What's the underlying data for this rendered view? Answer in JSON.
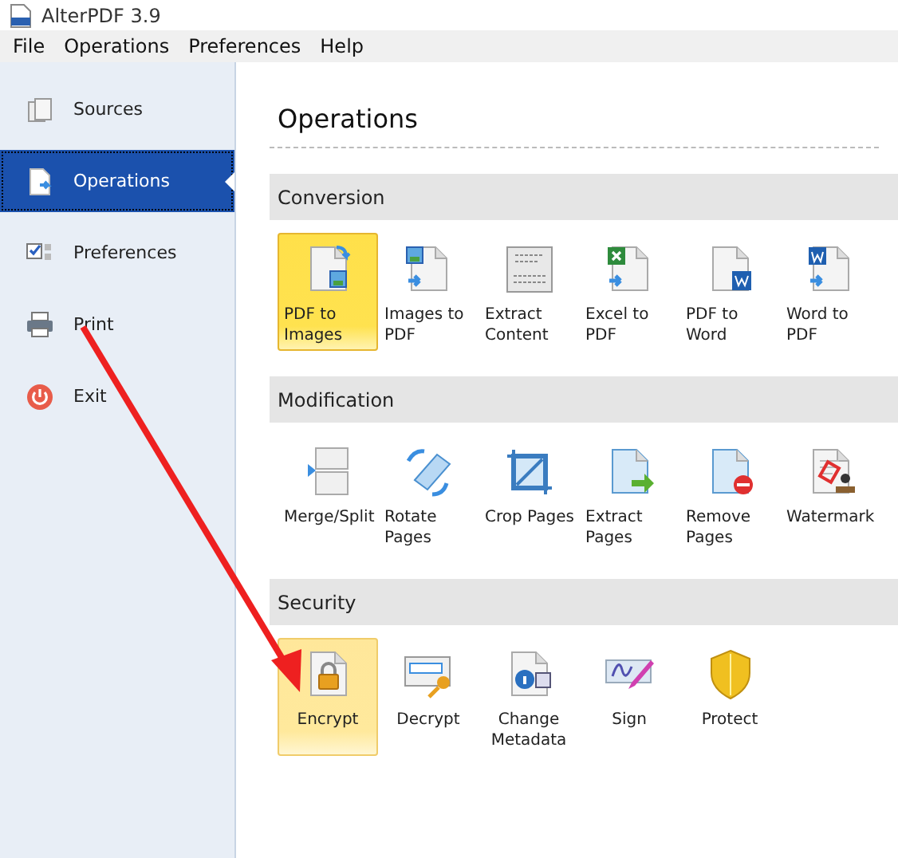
{
  "window": {
    "title": "AlterPDF 3.9"
  },
  "menu": [
    "File",
    "Operations",
    "Preferences",
    "Help"
  ],
  "sidebar": {
    "items": [
      {
        "label": "Sources",
        "selected": false
      },
      {
        "label": "Operations",
        "selected": true
      },
      {
        "label": "Preferences",
        "selected": false
      },
      {
        "label": "Print",
        "selected": false
      },
      {
        "label": "Exit",
        "selected": false
      }
    ]
  },
  "heading": "Operations",
  "sections": [
    {
      "title": "Conversion",
      "tiles": [
        {
          "label": "PDF to Images",
          "selected": true,
          "hovered": false
        },
        {
          "label": "Images to PDF",
          "selected": false,
          "hovered": false
        },
        {
          "label": "Extract Content",
          "selected": false,
          "hovered": false
        },
        {
          "label": "Excel to PDF",
          "selected": false,
          "hovered": false
        },
        {
          "label": "PDF to Word",
          "selected": false,
          "hovered": false
        },
        {
          "label": "Word to PDF",
          "selected": false,
          "hovered": false
        }
      ]
    },
    {
      "title": "Modification",
      "tiles": [
        {
          "label": "Merge/Split",
          "selected": false,
          "hovered": false
        },
        {
          "label": "Rotate Pages",
          "selected": false,
          "hovered": false
        },
        {
          "label": "Crop Pages",
          "selected": false,
          "hovered": false
        },
        {
          "label": "Extract Pages",
          "selected": false,
          "hovered": false
        },
        {
          "label": "Remove Pages",
          "selected": false,
          "hovered": false
        },
        {
          "label": "Watermark",
          "selected": false,
          "hovered": false
        }
      ]
    },
    {
      "title": "Security",
      "tiles": [
        {
          "label": "Encrypt",
          "selected": false,
          "hovered": true
        },
        {
          "label": "Decrypt",
          "selected": false,
          "hovered": false
        },
        {
          "label": "Change Metadata",
          "selected": false,
          "hovered": false
        },
        {
          "label": "Sign",
          "selected": false,
          "hovered": false
        },
        {
          "label": "Protect",
          "selected": false,
          "hovered": false
        }
      ]
    }
  ]
}
